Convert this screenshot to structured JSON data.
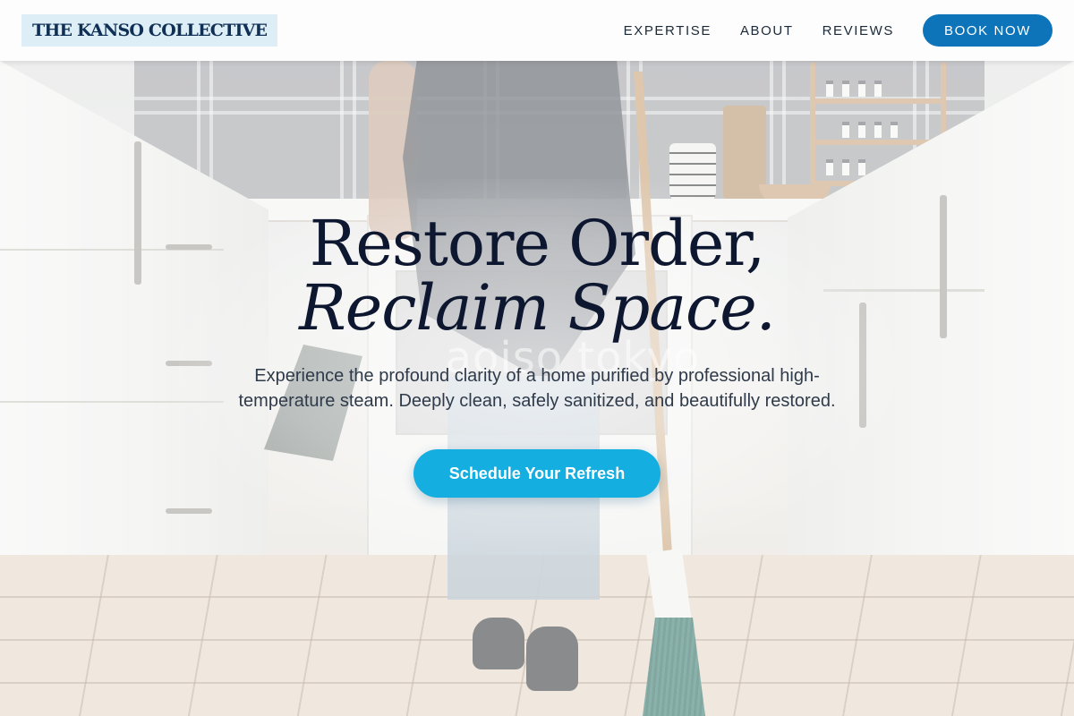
{
  "header": {
    "logo_text": "THE KANSO COLLECTIVE",
    "nav": [
      {
        "label": "EXPERTISE"
      },
      {
        "label": "ABOUT"
      },
      {
        "label": "REVIEWS"
      }
    ],
    "book_button": "BOOK NOW"
  },
  "hero": {
    "headline_line1": "Restore Order,",
    "headline_line2": "Reclaim Space.",
    "subtext": "Experience the profound clarity of a home purified by professional high-temperature steam. Deeply clean, safely sanitized, and beautifully restored.",
    "cta_label": "Schedule Your Refresh",
    "background_image": "kitchen-cleaning-photo",
    "watermark": "aoiso tokyo"
  },
  "colors": {
    "brand_navy": "#0e1730",
    "book_button_bg": "#0d74ba",
    "cta_bg": "#15aee0",
    "logo_bg": "#ddeef7"
  }
}
